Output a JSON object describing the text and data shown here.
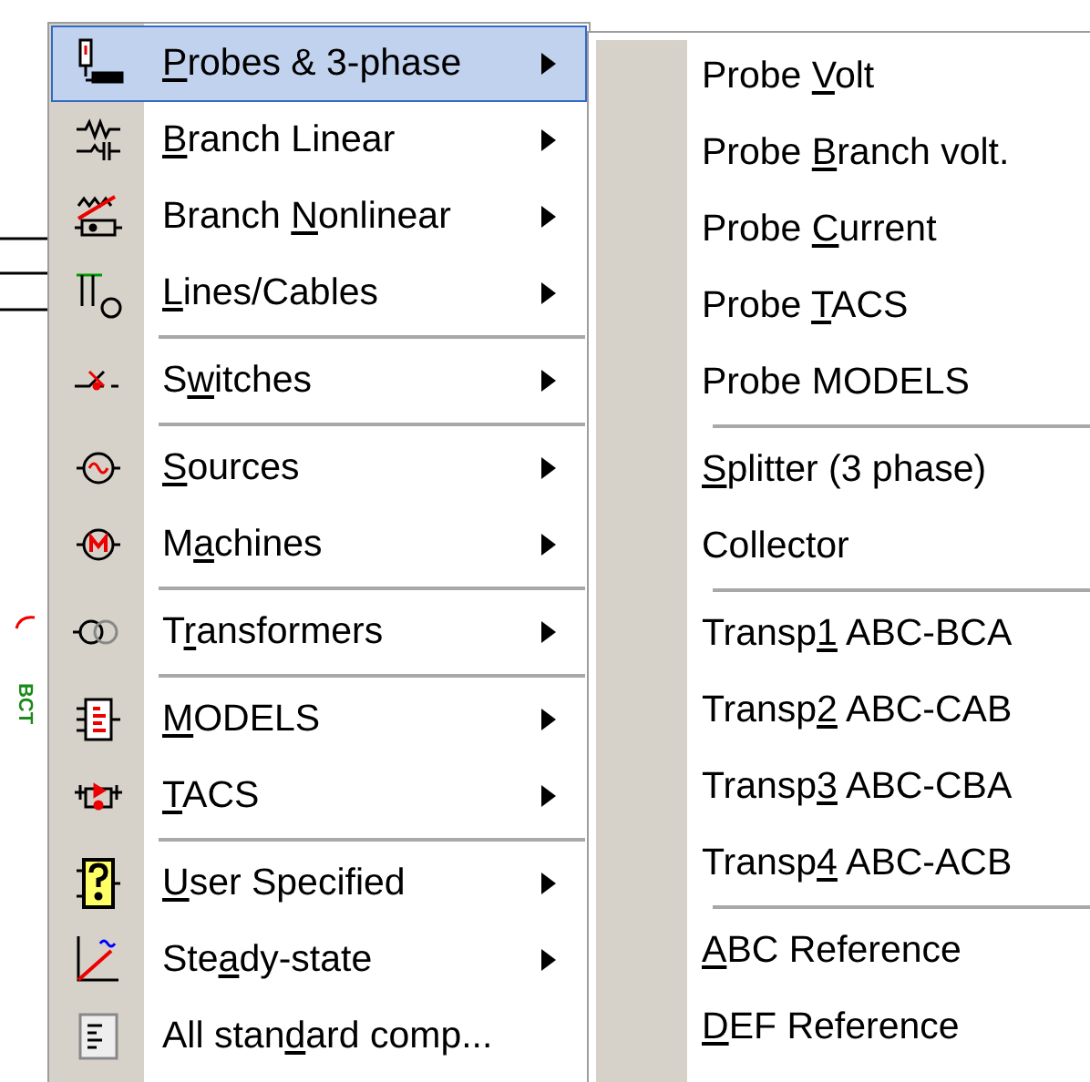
{
  "canvas": {
    "label": "BCT"
  },
  "menu": {
    "items": [
      {
        "kind": "item",
        "label": {
          "key": "P",
          "after": "robes & 3-phase"
        },
        "submenu": true,
        "selected": true
      },
      {
        "kind": "item",
        "label": {
          "key": "B",
          "after": "ranch Linear"
        },
        "submenu": true,
        "selected": false
      },
      {
        "kind": "item",
        "label": {
          "before": "Branch ",
          "key": "N",
          "after": "onlinear"
        },
        "submenu": true,
        "selected": false
      },
      {
        "kind": "item",
        "label": {
          "key": "L",
          "after": "ines/Cables"
        },
        "submenu": true,
        "selected": false
      },
      {
        "kind": "separator"
      },
      {
        "kind": "item",
        "label": {
          "before": "S",
          "key": "w",
          "after": "itches"
        },
        "submenu": true,
        "selected": false
      },
      {
        "kind": "separator"
      },
      {
        "kind": "item",
        "label": {
          "key": "S",
          "after": "ources"
        },
        "submenu": true,
        "selected": false
      },
      {
        "kind": "item",
        "label": {
          "before": "M",
          "key": "a",
          "after": "chines"
        },
        "submenu": true,
        "selected": false
      },
      {
        "kind": "separator"
      },
      {
        "kind": "item",
        "label": {
          "before": "T",
          "key": "r",
          "after": "ansformers"
        },
        "submenu": true,
        "selected": false
      },
      {
        "kind": "separator"
      },
      {
        "kind": "item",
        "label": {
          "key": "M",
          "after": "ODELS"
        },
        "submenu": true,
        "selected": false
      },
      {
        "kind": "item",
        "label": {
          "key": "T",
          "after": "ACS"
        },
        "submenu": true,
        "selected": false
      },
      {
        "kind": "separator"
      },
      {
        "kind": "item",
        "label": {
          "key": "U",
          "after": "ser Specified"
        },
        "submenu": true,
        "selected": false
      },
      {
        "kind": "item",
        "label": {
          "before": "Ste",
          "key": "a",
          "after": "dy-state"
        },
        "submenu": true,
        "selected": false
      },
      {
        "kind": "item",
        "label": {
          "before": "All stan",
          "key": "d",
          "after": "ard comp..."
        },
        "submenu": false,
        "selected": false
      }
    ]
  },
  "submenu": {
    "items": [
      {
        "kind": "item",
        "label": {
          "before": "Probe ",
          "key": "V",
          "after": "olt"
        }
      },
      {
        "kind": "item",
        "label": {
          "before": "Probe ",
          "key": "B",
          "after": "ranch volt."
        }
      },
      {
        "kind": "item",
        "label": {
          "before": "Probe ",
          "key": "C",
          "after": "urrent"
        }
      },
      {
        "kind": "item",
        "label": {
          "before": "Probe ",
          "key": "T",
          "after": "ACS"
        }
      },
      {
        "kind": "item",
        "label": {
          "before": "Probe MODELS"
        }
      },
      {
        "kind": "separator"
      },
      {
        "kind": "item",
        "label": {
          "key": "S",
          "after": "plitter (3 phase)"
        }
      },
      {
        "kind": "item",
        "label": {
          "before": "Collector"
        }
      },
      {
        "kind": "separator"
      },
      {
        "kind": "item",
        "label": {
          "before": "Transp",
          "key": "1",
          "after": " ABC-BCA"
        }
      },
      {
        "kind": "item",
        "label": {
          "before": "Transp",
          "key": "2",
          "after": " ABC-CAB"
        }
      },
      {
        "kind": "item",
        "label": {
          "before": "Transp",
          "key": "3",
          "after": " ABC-CBA"
        }
      },
      {
        "kind": "item",
        "label": {
          "before": "Transp",
          "key": "4",
          "after": " ABC-ACB"
        }
      },
      {
        "kind": "separator"
      },
      {
        "kind": "item",
        "label": {
          "key": "A",
          "after": "BC Reference"
        }
      },
      {
        "kind": "item",
        "label": {
          "key": "D",
          "after": "EF Reference"
        }
      }
    ]
  }
}
